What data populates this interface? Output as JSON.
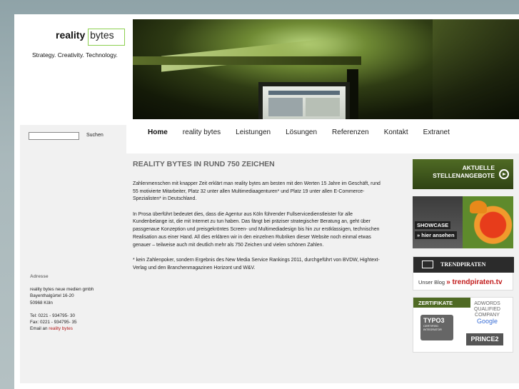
{
  "logo": {
    "brand": "reality",
    "boxed": "bytes",
    "tagline": "Strategy. Creativity. Technology."
  },
  "nav": [
    "Home",
    "reality bytes",
    "Leistungen",
    "Lösungen",
    "Referenzen",
    "Kontakt",
    "Extranet"
  ],
  "search": {
    "placeholder": "",
    "button": "Suchen"
  },
  "address": {
    "title": "Adresse",
    "lines": [
      "reality bytes neue medien gmbh",
      "Bayenthalgürtel 16-20",
      "50968 Köln"
    ],
    "tel": "Tel: 0221 - 934795- 30",
    "fax": "Fax: 0221 - 934795- 35",
    "email_prefix": "Email an",
    "email_link": "reality bytes"
  },
  "main": {
    "heading": "REALITY BYTES IN RUND 750 ZEICHEN",
    "paragraphs": [
      "Zahlenmenschen mit knapper Zeit erklärt man reality bytes am besten mit den Werten 15 Jahre im Geschäft, rund 55 motivierte Mitarbeiter, Platz 32 unter allen Multimediaagenturen* und Platz 19 unter allen E-Commerce-Spezialisten* in Deutschland.",
      "In Prosa überführt bedeutet dies, dass die Agentur aus Köln führender Fullservicedienstleister für alle Kundenbelange ist, die mit Internet zu tun haben. Das fängt bei präziser strategischer Beratung an, geht über passgenaue Konzeption und preisgekröntes Screen- und Multimediadesign bis hin zur erstklassigen, technischen Realisation aus einer Hand. All dies erklären wir in den einzelnen Rubriken dieser Website noch einmal etwas genauer – teilweise auch mit deutlich mehr als 750 Zeichen und vielen schönen Zahlen.",
      "* kein Zahlenpoker, sondern Ergebnis des New Media Service Rankings 2011, durchgeführt von BVDW, Hightext-Verlag und den Branchenmagazinen Horizont und W&V."
    ]
  },
  "sidebar": {
    "jobs_line1": "AKTUELLE",
    "jobs_line2": "STELLENANGEBOTE",
    "showcase_title": "SHOWCASE",
    "showcase_link": "» hier ansehen",
    "trend_logo": "TRENDPIRATEN",
    "trend_prefix": "Unser Blog",
    "trend_link": "» trendpiraten.tv",
    "certs_title": "ZERTIFIKATE",
    "typo3": "TYPO3",
    "typo3_sub1": "CERTIFIED",
    "typo3_sub2": "INTEGRATOR",
    "adwords1": "ADWORDS",
    "adwords2": "QUALIFIED",
    "adwords3": "COMPANY",
    "google": "Google",
    "prince": "PRINCE2"
  },
  "colors": {
    "accent_green": "#4f6a24",
    "link_red": "#b31b1b",
    "logo_box": "#8ccf4f"
  }
}
